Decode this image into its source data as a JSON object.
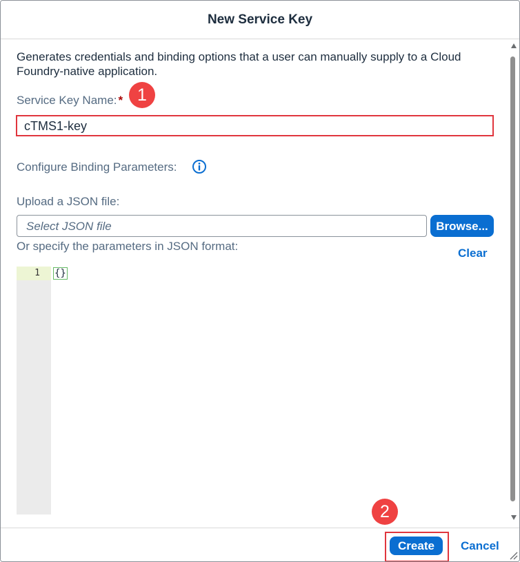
{
  "dialog": {
    "title": "New Service Key",
    "description": "Generates credentials and binding options that a user can manually supply to a Cloud Foundry-native application.",
    "service_key_name_label": "Service Key Name:",
    "required_marker": "*",
    "service_key_name_value": "cTMS1-key",
    "binding_params_label": "Configure Binding Parameters:",
    "upload_label": "Upload a JSON file:",
    "file_placeholder": "Select JSON file",
    "browse_label": "Browse...",
    "json_format_label": "Or specify the parameters in JSON format:",
    "clear_label": "Clear",
    "editor": {
      "line_number": "1",
      "code": "{}"
    }
  },
  "footer": {
    "create_label": "Create",
    "cancel_label": "Cancel"
  },
  "callouts": {
    "step1": "1",
    "step2": "2"
  },
  "colors": {
    "accent": "#0a6ed1",
    "highlight": "#e0353d",
    "callout": "#ef4242"
  }
}
